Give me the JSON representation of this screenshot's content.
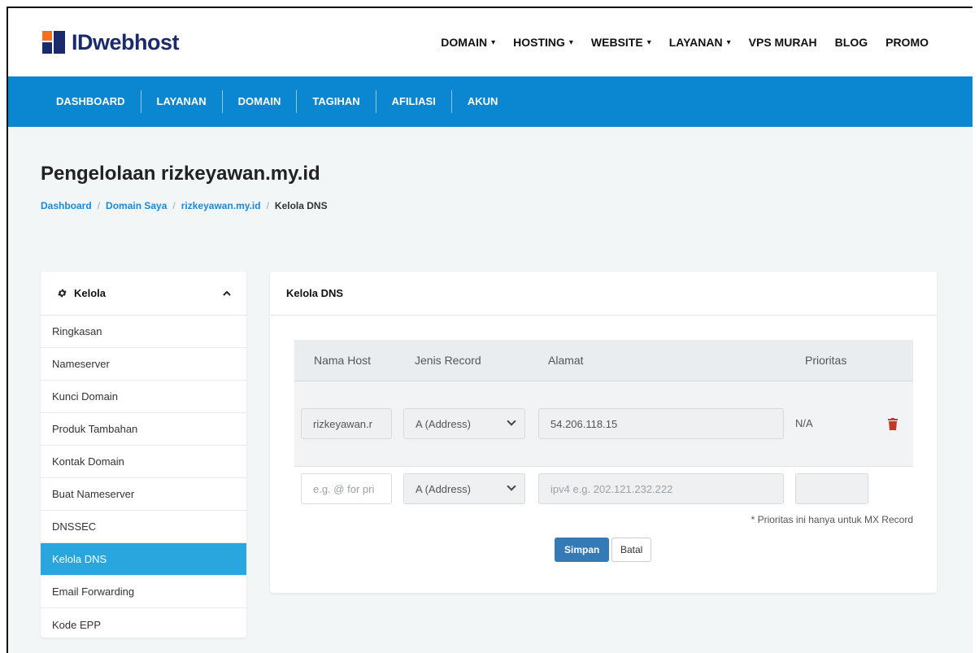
{
  "brand": {
    "name": "IDwebhost"
  },
  "topnav": [
    {
      "label": "DOMAIN",
      "dropdown": true
    },
    {
      "label": "HOSTING",
      "dropdown": true
    },
    {
      "label": "WEBSITE",
      "dropdown": true
    },
    {
      "label": "LAYANAN",
      "dropdown": true
    },
    {
      "label": "VPS MURAH",
      "dropdown": false
    },
    {
      "label": "BLOG",
      "dropdown": false
    },
    {
      "label": "PROMO",
      "dropdown": false
    }
  ],
  "subnav": [
    "DASHBOARD",
    "LAYANAN",
    "DOMAIN",
    "TAGIHAN",
    "AFILIASI",
    "AKUN"
  ],
  "page": {
    "title": "Pengelolaan rizkeyawan.my.id",
    "breadcrumb": [
      "Dashboard",
      "Domain Saya",
      "rizkeyawan.my.id",
      "Kelola DNS"
    ]
  },
  "sidebar": {
    "title": "Kelola",
    "icon": "gear-icon",
    "collapse_icon": "chevron-up-icon",
    "items": [
      "Ringkasan",
      "Nameserver",
      "Kunci Domain",
      "Produk Tambahan",
      "Kontak Domain",
      "Buat Nameserver",
      "DNSSEC",
      "Kelola DNS",
      "Email Forwarding",
      "Kode EPP"
    ],
    "active": "Kelola DNS"
  },
  "panel": {
    "title": "Kelola DNS",
    "columns": [
      "Nama Host",
      "Jenis Record",
      "Alamat",
      "Prioritas"
    ],
    "record": {
      "host": "rizkeyawan.r",
      "type": "A (Address)",
      "address": "54.206.118.15",
      "priority": "N/A"
    },
    "new_record": {
      "host_placeholder": "e.g. @ for pri",
      "type": "A (Address)",
      "address_placeholder": "ipv4 e.g. 202.121.232.222",
      "priority_value": ""
    },
    "note": "* Prioritas ini hanya untuk MX Record",
    "save_label": "Simpan",
    "cancel_label": "Batal"
  },
  "colors": {
    "brand_navy": "#1a2a6c",
    "brand_orange": "#f36f21",
    "nav_blue": "#0a87d0",
    "active_item": "#29a6dd",
    "save_button": "#337ab7",
    "trash": "#c0392b"
  }
}
